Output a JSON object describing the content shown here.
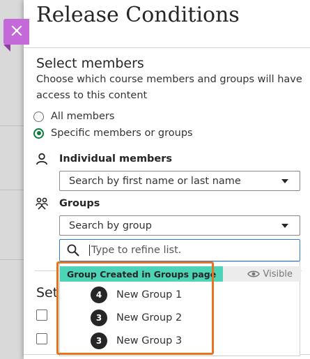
{
  "panel": {
    "title": "Release Conditions"
  },
  "members": {
    "heading": "Select members",
    "description": "Choose which course members and groups will have access to this content",
    "options": [
      {
        "label": "All members",
        "selected": false
      },
      {
        "label": "Specific members or groups",
        "selected": true
      }
    ]
  },
  "individual": {
    "label": "Individual members",
    "placeholder": "Search by first name or last name",
    "icon": "person-icon"
  },
  "groups": {
    "label": "Groups",
    "placeholder": "Search by group",
    "icon": "people-icon",
    "refine_placeholder": "Type to refine list.",
    "set_name": "Group Created in Groups page",
    "visibility": "Visible",
    "items": [
      {
        "count": "4",
        "name": "New Group 1"
      },
      {
        "count": "3",
        "name": "New Group 2"
      },
      {
        "count": "3",
        "name": "New Group 3"
      }
    ]
  },
  "partial_section": {
    "heading": "Set"
  },
  "colors": {
    "accent_purple": "#c36ad8",
    "radio_green": "#0a7d3b",
    "focus_blue": "#2f7dd1",
    "group_teal": "#4dd3b6",
    "callout_orange": "#e8731f"
  }
}
